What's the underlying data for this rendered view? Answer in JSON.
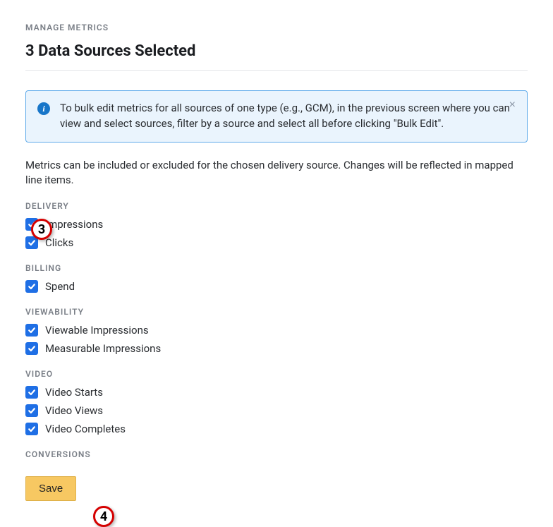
{
  "breadcrumb": "MANAGE METRICS",
  "title": "3 Data Sources Selected",
  "alert": {
    "icon_glyph": "i",
    "text": "To bulk edit metrics for all sources of one type (e.g., GCM), in the previous screen where you can view and select sources, filter by a source and select all before clicking \"Bulk Edit\".",
    "close": "×"
  },
  "description": "Metrics can be included or excluded for the chosen delivery source. Changes will be reflected in mapped line items.",
  "sections": [
    {
      "header": "DELIVERY",
      "items": [
        {
          "label": "Impressions",
          "checked": true
        },
        {
          "label": "Clicks",
          "checked": true
        }
      ]
    },
    {
      "header": "BILLING",
      "items": [
        {
          "label": "Spend",
          "checked": true
        }
      ]
    },
    {
      "header": "VIEWABILITY",
      "items": [
        {
          "label": "Viewable Impressions",
          "checked": true
        },
        {
          "label": "Measurable Impressions",
          "checked": true
        }
      ]
    },
    {
      "header": "VIDEO",
      "items": [
        {
          "label": "Video Starts",
          "checked": true
        },
        {
          "label": "Video Views",
          "checked": true
        },
        {
          "label": "Video Completes",
          "checked": true
        }
      ]
    },
    {
      "header": "CONVERSIONS",
      "items": []
    }
  ],
  "save_label": "Save",
  "annotations": {
    "marker_3": "3",
    "marker_4": "4"
  }
}
